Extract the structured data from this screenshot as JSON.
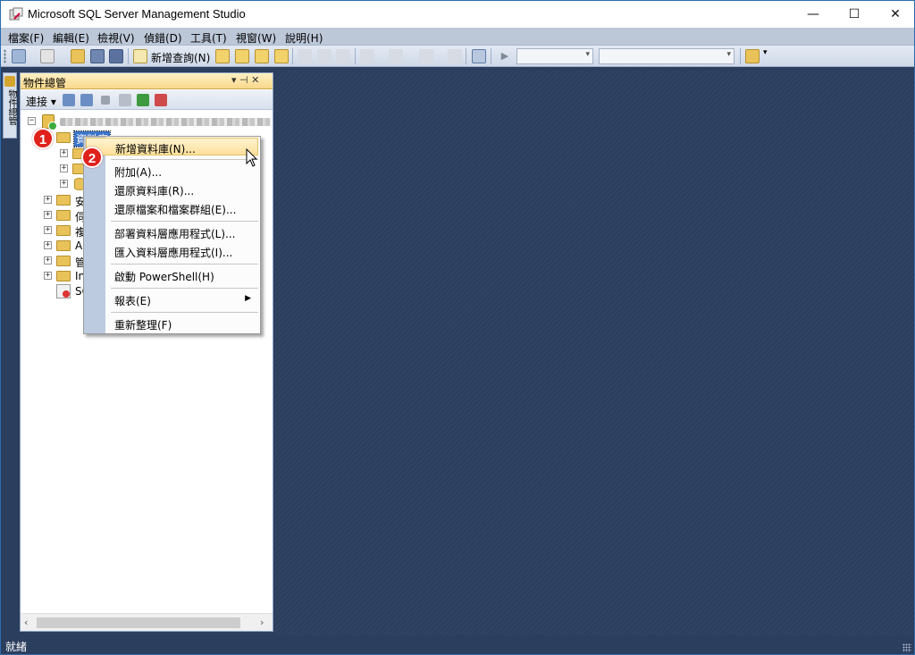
{
  "window": {
    "title": "Microsoft SQL Server Management Studio",
    "minimize": "—",
    "maximize": "☐",
    "close": "✕"
  },
  "menubar": {
    "items": [
      "檔案(F)",
      "編輯(E)",
      "檢視(V)",
      "偵錯(D)",
      "工具(T)",
      "視窗(W)",
      "說明(H)"
    ]
  },
  "toolbar": {
    "new_query_label": "新增查詢(N)"
  },
  "left_strip": {
    "tab_label": "物件總管"
  },
  "object_explorer": {
    "title": "物件總管",
    "pin": "▾ ⊣ ✕",
    "connect_label": "連接 ▾",
    "tree": {
      "databases_label": "資料庫",
      "truncated_items": [
        "安",
        "伺",
        "複",
        "Al",
        "管",
        "In",
        "SC"
      ]
    }
  },
  "context_menu": {
    "items": [
      {
        "label": "新增資料庫(N)..."
      },
      {
        "label": "附加(A)..."
      },
      {
        "label": "還原資料庫(R)..."
      },
      {
        "label": "還原檔案和檔案群組(E)..."
      },
      {
        "label": "部署資料層應用程式(L)..."
      },
      {
        "label": "匯入資料層應用程式(I)..."
      },
      {
        "label": "啟動 PowerShell(H)"
      },
      {
        "label": "報表(E)",
        "submenu_arrow": "▶"
      },
      {
        "label": "重新整理(F)"
      }
    ]
  },
  "badges": [
    "1",
    "2"
  ],
  "statusbar": {
    "text": "就緒"
  },
  "colors": {
    "workspace": "#2c3e5e",
    "menubar": "#bcc7d8",
    "panel_header": "#f9d88b",
    "selection": "#3b74c9",
    "badge": "#e0211b",
    "menu_gutter": "#bccbe0"
  }
}
